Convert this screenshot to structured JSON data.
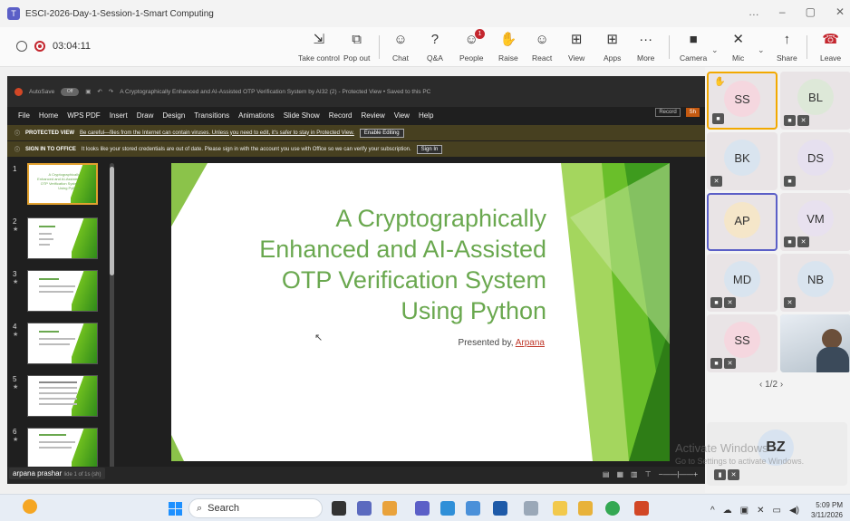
{
  "window": {
    "title": "ESCI-2026-Day-1-Session-1-Smart Computing",
    "controls": [
      "…",
      "–",
      "▢",
      "✕"
    ]
  },
  "meeting": {
    "timer": "03:04:11"
  },
  "toolbar": [
    {
      "label": "Take control",
      "icon": "⇲"
    },
    {
      "label": "Pop out",
      "icon": "⧉"
    },
    {
      "label": "Chat",
      "icon": "☺"
    },
    {
      "label": "Q&A",
      "icon": "?"
    },
    {
      "label": "People",
      "icon": "☺",
      "badge": "1"
    },
    {
      "label": "Raise",
      "icon": "✋"
    },
    {
      "label": "React",
      "icon": "☺"
    },
    {
      "label": "View",
      "icon": "⊞"
    },
    {
      "label": "Apps",
      "icon": "⊞"
    },
    {
      "label": "More",
      "icon": "···"
    },
    {
      "label": "Camera",
      "icon": "■"
    },
    {
      "label": "Mic",
      "icon": "✕"
    },
    {
      "label": "Share",
      "icon": "↑"
    },
    {
      "label": "Leave",
      "icon": "☎"
    }
  ],
  "ppt": {
    "autosave": "AutoSave",
    "autosave_state": "Off",
    "doc_title": "A Cryptographically Enhanced and AI-Assisted OTP Verification System by AI32 (2) - Protected View • Saved to this PC",
    "menu": [
      "File",
      "Home",
      "WPS PDF",
      "Insert",
      "Draw",
      "Design",
      "Transitions",
      "Animations",
      "Slide Show",
      "Record",
      "Review",
      "View",
      "Help"
    ],
    "record_btn": "Record",
    "share_btn": "Sh",
    "protected": {
      "label": "PROTECTED VIEW",
      "message": "Be careful—files from the Internet can contain viruses. Unless you need to edit, it's safer to stay in Protected View.",
      "button": "Enable Editing"
    },
    "signin": {
      "label": "SIGN IN TO OFFICE",
      "message": "It looks like your stored credentials are out of date. Please sign in with the account you use with Office so we can verify your subscription.",
      "button": "Sign In"
    },
    "slides": [
      {
        "num": "1",
        "title": "A Cryptographically Enhanced and AI-Assisted OTP Verification System Using Python"
      },
      {
        "num": "2",
        "title": ""
      },
      {
        "num": "3",
        "title": ""
      },
      {
        "num": "4",
        "title": ""
      },
      {
        "num": "5",
        "title": ""
      },
      {
        "num": "6",
        "title": ""
      }
    ],
    "slide": {
      "lines": [
        "A Cryptographically",
        "Enhanced and AI-Assisted",
        "OTP Verification System",
        "Using Python"
      ],
      "presented_by": "Presented by,",
      "presenter": "Arpana"
    },
    "presenter_name": "arpana prashar",
    "presenter_name_tail": "lide 1 of 1s (sh)"
  },
  "participants": [
    {
      "initials": "SS",
      "bg": "#f5d7df"
    },
    {
      "initials": "BL",
      "bg": "#dde8d8"
    },
    {
      "initials": "BK",
      "bg": "#d9e4ef"
    },
    {
      "initials": "DS",
      "bg": "#e6e0ef"
    },
    {
      "initials": "AP",
      "bg": "#f5e6c9"
    },
    {
      "initials": "VM",
      "bg": "#e8e1ef"
    },
    {
      "initials": "MD",
      "bg": "#d9e4ef"
    },
    {
      "initials": "NB",
      "bg": "#d9e4ef"
    },
    {
      "initials": "SS",
      "bg": "#f5d7df"
    },
    {
      "initials": "BZ",
      "bg": "#d8e3f0"
    }
  ],
  "pager": "1/2",
  "watermark": {
    "line1": "Activate Windows",
    "line2": "Go to Settings to activate Windows."
  },
  "taskbar": {
    "search": "Search",
    "time": "5:09 PM",
    "date": "3/11/2026"
  }
}
